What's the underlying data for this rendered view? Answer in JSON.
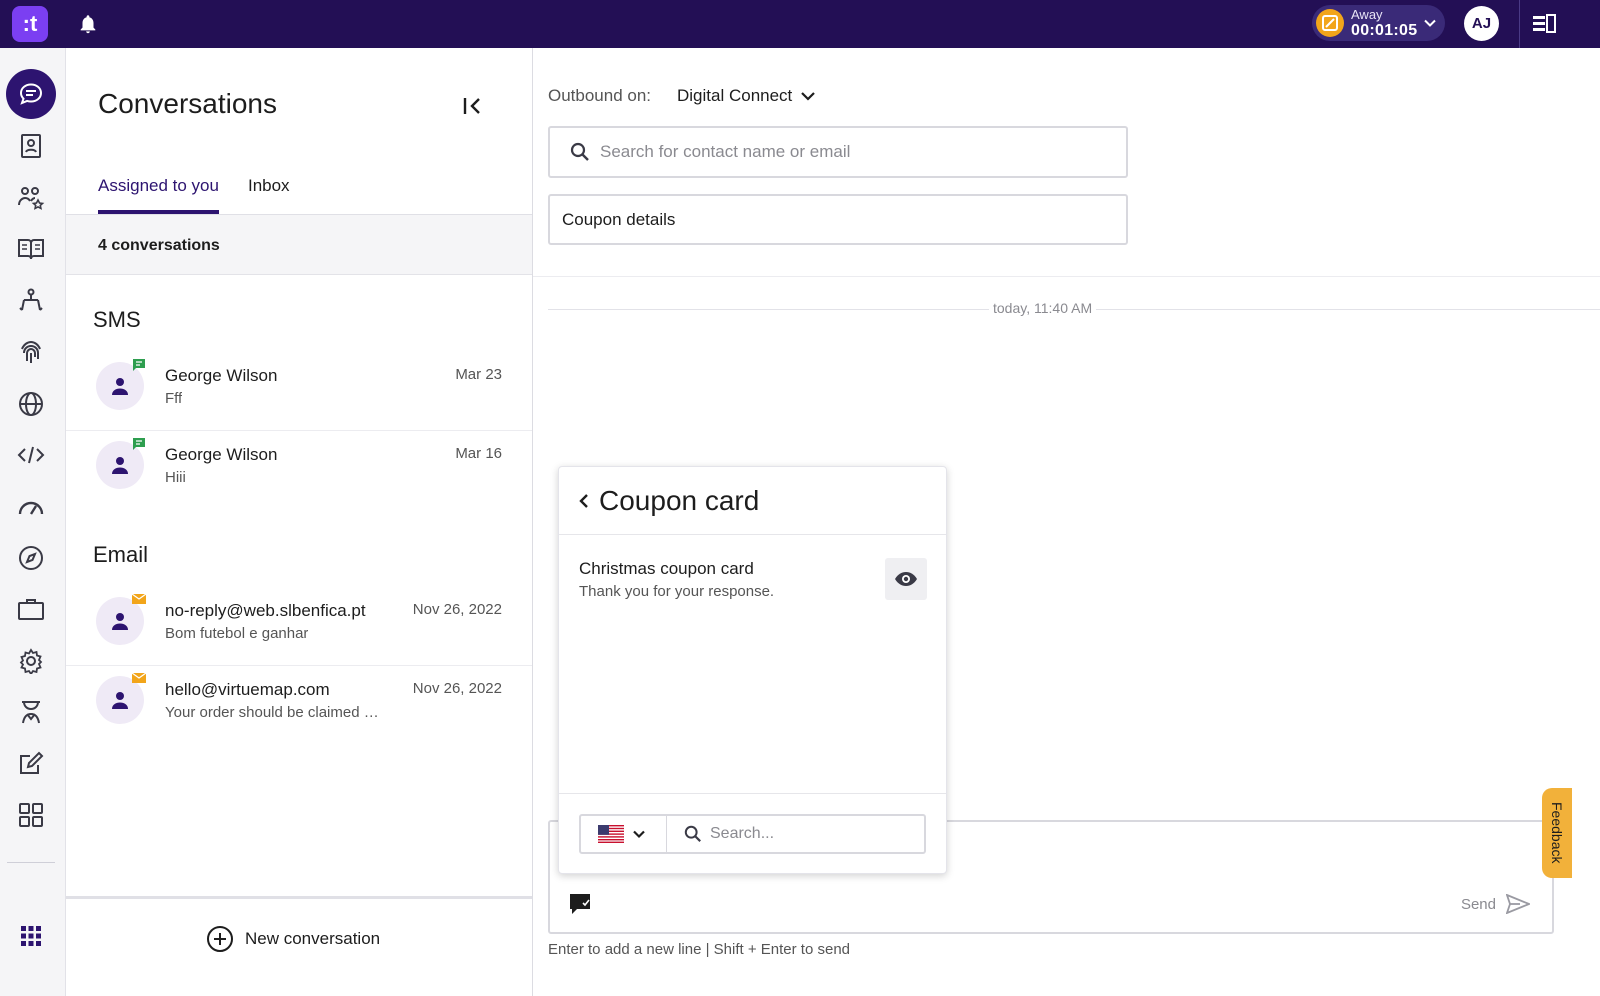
{
  "topbar": {
    "logo_text": ":t",
    "status": {
      "label": "Away",
      "timer": "00:01:05"
    },
    "user_initials": "AJ"
  },
  "rail": {
    "items": [
      {
        "icon": "conversations-icon",
        "active": true
      },
      {
        "icon": "contacts-book-icon"
      },
      {
        "icon": "team-star-icon"
      },
      {
        "icon": "knowledge-book-icon"
      },
      {
        "icon": "flow-icon"
      },
      {
        "icon": "fingerprint-icon"
      },
      {
        "icon": "globe-icon"
      },
      {
        "icon": "code-icon"
      },
      {
        "icon": "speedometer-icon"
      },
      {
        "icon": "compass-icon"
      },
      {
        "icon": "briefcase-icon"
      },
      {
        "icon": "gear-icon"
      },
      {
        "icon": "agent-icon"
      },
      {
        "icon": "edit-icon"
      },
      {
        "icon": "dashboard-grid-icon"
      },
      {
        "icon": "apps-grid-icon"
      }
    ]
  },
  "conversations": {
    "title": "Conversations",
    "tabs": [
      {
        "label": "Assigned to you",
        "active": true
      },
      {
        "label": "Inbox",
        "active": false
      }
    ],
    "count_label": "4 conversations",
    "sections": [
      {
        "heading": "SMS",
        "items": [
          {
            "name": "George Wilson",
            "preview": "Fff",
            "date": "Mar 23",
            "channel": "sms"
          },
          {
            "name": "George Wilson",
            "preview": "Hiii",
            "date": "Mar 16",
            "channel": "sms"
          }
        ]
      },
      {
        "heading": "Email",
        "items": [
          {
            "name": "no-reply@web.slbenfica.pt",
            "preview": "Bom futebol e ganhar",
            "date": "Nov 26, 2022",
            "channel": "email"
          },
          {
            "name": "hello@virtuemap.com",
            "preview": "Your order should be claimed today",
            "date": "Nov 26, 2022",
            "channel": "email"
          }
        ]
      }
    ],
    "new_conversation_label": "New conversation"
  },
  "main": {
    "outbound_label": "Outbound on:",
    "outbound_value": "Digital Connect",
    "search_placeholder": "Search for contact name or email",
    "subject_value": "Coupon details",
    "timestamp": "today, 11:40 AM",
    "coupon_card": {
      "title": "Coupon card",
      "item": {
        "title": "Christmas coupon card",
        "subtitle": "Thank you for your response."
      },
      "search_placeholder": "Search..."
    },
    "composer": {
      "send_label": "Send",
      "hint": "Enter to add a new line | Shift + Enter to send"
    },
    "feedback_label": "Feedback"
  },
  "colors": {
    "topbar": "#230f55",
    "accent": "#2d1470",
    "logo": "#7b3ff2",
    "away": "#f2a51a",
    "sms_badge": "#2e9e4f",
    "email_badge": "#f2a51a",
    "feedback": "#f2b13a"
  }
}
